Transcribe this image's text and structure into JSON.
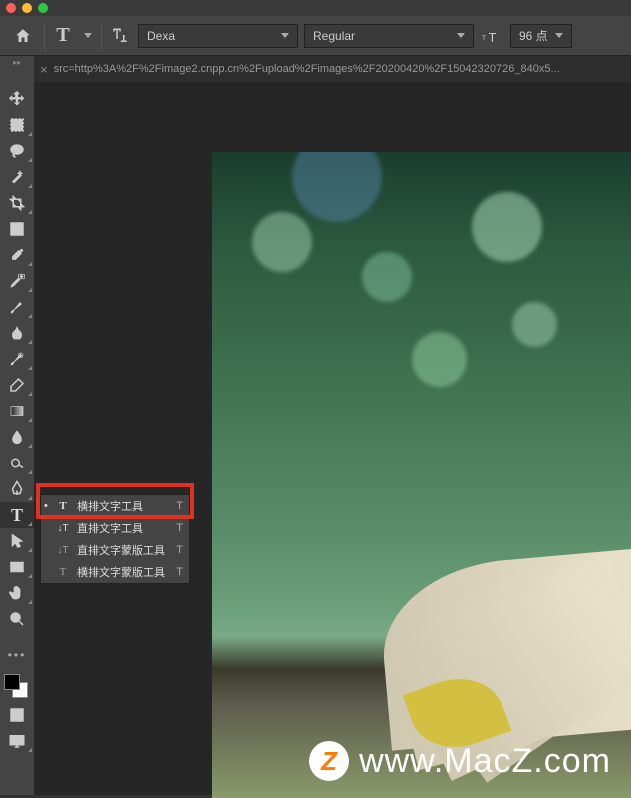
{
  "toolbar": {
    "font_family": "Dexa",
    "font_style": "Regular",
    "font_size": "96 点"
  },
  "tab": {
    "title": "src=http%3A%2F%2Fimage2.cnpp.cn%2Fupload%2Fimages%2F20200420%2F15042320726_840x5..."
  },
  "flyout": {
    "items": [
      {
        "label": "横排文字工具",
        "shortcut": "T",
        "icon": "T"
      },
      {
        "label": "直排文字工具",
        "shortcut": "T",
        "icon": "⊥T"
      },
      {
        "label": "直排文字蒙版工具",
        "shortcut": "T",
        "icon": "⊥T"
      },
      {
        "label": "横排文字蒙版工具",
        "shortcut": "T",
        "icon": "T"
      }
    ]
  },
  "watermark": {
    "badge": "Z",
    "text": "www.MacZ.com"
  }
}
